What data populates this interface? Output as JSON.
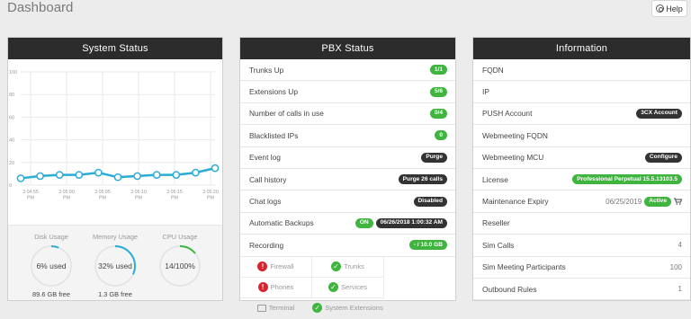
{
  "header": {
    "title": "Dashboard",
    "help_label": "Help"
  },
  "system_status": {
    "title": "System Status",
    "chart_data": {
      "type": "line",
      "x": [
        "3:04:55 PM",
        "3:05:00 PM",
        "3:05:05 PM",
        "3:05:10 PM",
        "3:05:15 PM",
        "3:05:20 PM"
      ],
      "x_tick_labels": [
        [
          "3:04:55",
          "PM"
        ],
        [
          "3:05:00",
          "PM"
        ],
        [
          "3:05:05",
          "PM"
        ],
        [
          "3:05:10",
          "PM"
        ],
        [
          "3:05:15",
          "PM"
        ],
        [
          "3:05:20",
          "PM"
        ]
      ],
      "y_ticks": [
        "100",
        "80",
        "60",
        "40",
        "20",
        "0"
      ],
      "ylim": [
        0,
        100
      ],
      "grid": true,
      "series": [
        {
          "color": "#2bacd6",
          "values": [
            6,
            8,
            9,
            9,
            11,
            7,
            8,
            9,
            9,
            11,
            15
          ]
        }
      ]
    },
    "usage": [
      {
        "title": "Disk Usage",
        "value": "6% used",
        "percent": 6,
        "free": "89.6 GB free"
      },
      {
        "title": "Memory Usage",
        "value": "32% used",
        "percent": 32,
        "free": "1.3 GB free"
      },
      {
        "title": "CPU Usage",
        "value": "14/100%",
        "percent": 14,
        "free": ""
      }
    ]
  },
  "pbx": {
    "title": "PBX Status",
    "rows": [
      {
        "label": "Trunks Up",
        "badges": [
          {
            "text": "1/1",
            "style": "g"
          }
        ]
      },
      {
        "label": "Extensions Up",
        "badges": [
          {
            "text": "5/6",
            "style": "g"
          }
        ]
      },
      {
        "label": "Number of calls in use",
        "badges": [
          {
            "text": "0/4",
            "style": "g"
          }
        ]
      },
      {
        "label": "Blacklisted IPs",
        "badges": [
          {
            "text": "0",
            "style": "g"
          }
        ]
      },
      {
        "label": "Event log",
        "badges": [
          {
            "text": "Purge",
            "style": "d"
          }
        ]
      },
      {
        "label": "Call history",
        "badges": [
          {
            "text": "Purge 26 calls",
            "style": "d"
          }
        ]
      },
      {
        "label": "Chat logs",
        "badges": [
          {
            "text": "Disabled",
            "style": "d"
          }
        ]
      },
      {
        "label": "Automatic Backups",
        "badges": [
          {
            "text": "ON",
            "style": "g"
          },
          {
            "text": "06/26/2018 1:00:32 AM",
            "style": "d"
          }
        ]
      },
      {
        "label": "Recording",
        "badges": [
          {
            "text": "- / 10.0 GB",
            "style": "g"
          }
        ]
      }
    ],
    "services": [
      {
        "label": "Firewall",
        "status": "error"
      },
      {
        "label": "Trunks",
        "status": "ok"
      },
      {
        "label": "Phones",
        "status": "error"
      },
      {
        "label": "Services",
        "status": "ok"
      },
      {
        "label": "Terminal",
        "status": "terminal"
      },
      {
        "label": "System Extensions",
        "status": "ok"
      }
    ]
  },
  "info": {
    "title": "Information",
    "rows": [
      {
        "label": "FQDN"
      },
      {
        "label": "IP"
      },
      {
        "label": "PUSH Account",
        "badge": {
          "text": "3CX Account",
          "style": "d"
        }
      },
      {
        "label": "Webmeeting FQDN"
      },
      {
        "label": "Webmeeting MCU",
        "badge": {
          "text": "Configure",
          "style": "d"
        }
      },
      {
        "label": "License",
        "badge": {
          "text": "Professional Perpetual 15.5.13103.5",
          "style": "g"
        }
      },
      {
        "label": "Maintenance Expiry",
        "value": "06/25/2019",
        "badge": {
          "text": "Active",
          "style": "g"
        },
        "icon": "cart-icon"
      },
      {
        "label": "Reseller"
      },
      {
        "label": "Sim Calls",
        "value": "4"
      },
      {
        "label": "Sim Meeting Participants",
        "value": "100"
      },
      {
        "label": "Outbound Rules",
        "value": "1"
      }
    ]
  }
}
